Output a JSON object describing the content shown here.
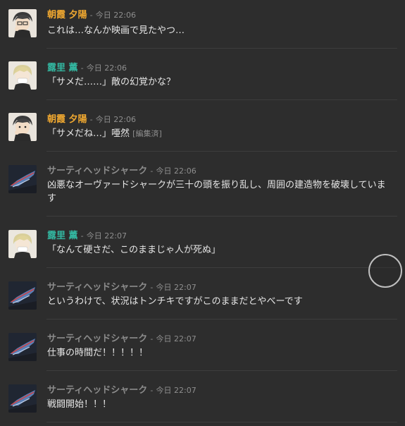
{
  "colors": {
    "background": "#2d2d2d",
    "asagiri": "#f0a830",
    "kiri": "#33b6a0",
    "shark": "#8b8b8b",
    "timestamp": "#8e8e8e"
  },
  "messages": [
    {
      "author": "朝霞 夕陽",
      "time": "今日 22:06",
      "text": "これは…なんか映画で見たやつ…",
      "edited": ""
    },
    {
      "author": "露里 薫",
      "time": "今日 22:06",
      "text": "「サメだ……」敵の幻覚かな？",
      "edited": ""
    },
    {
      "author": "朝霞 夕陽",
      "time": "今日 22:06",
      "text": "「サメだね…」唖然",
      "edited": "[編集済]"
    },
    {
      "author": "サーティヘッドシャーク",
      "time": "今日 22:06",
      "text": "凶悪なオーヴァードシャークが三十の頭を振り乱し、周囲の建造物を破壊しています",
      "edited": ""
    },
    {
      "author": "露里 薫",
      "time": "今日 22:07",
      "text": "「なんて硬さだ、このままじゃ人が死ぬ」",
      "edited": ""
    },
    {
      "author": "サーティヘッドシャーク",
      "time": "今日 22:07",
      "text": "というわけで、状況はトンチキですがこのままだとやべーです",
      "edited": ""
    },
    {
      "author": "サーティヘッドシャーク",
      "time": "今日 22:07",
      "text": "仕事の時間だ！！！！！",
      "edited": ""
    },
    {
      "author": "サーティヘッドシャーク",
      "time": "今日 22:07",
      "text": "戦闘開始！！！",
      "edited": ""
    }
  ],
  "separator": "-"
}
